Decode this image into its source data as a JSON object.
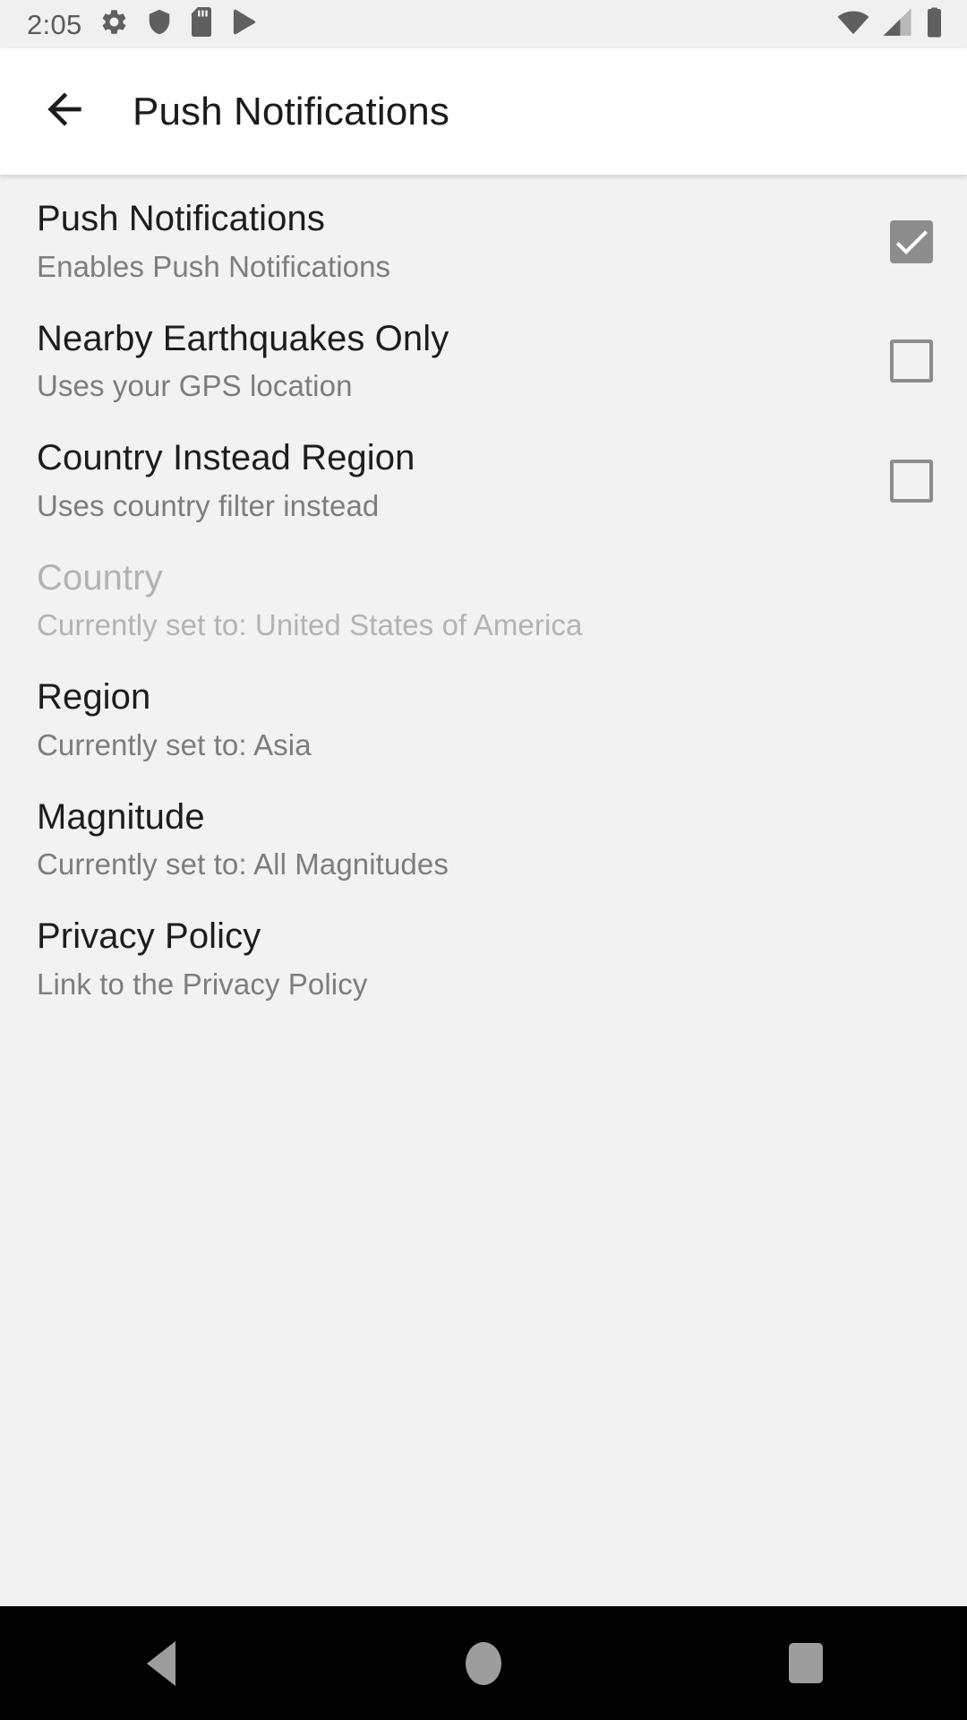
{
  "status_bar": {
    "time": "2:05",
    "left_icons": [
      "gear-icon",
      "shield-icon",
      "sd-card-icon",
      "play-store-icon"
    ],
    "right_icons": [
      "wifi-icon",
      "cellular-signal-icon",
      "battery-icon"
    ],
    "icon_color": "#5f5f5f",
    "background": "#f0f0f0"
  },
  "app_bar": {
    "back_icon": "arrow-left-icon",
    "title": "Push Notifications",
    "background": "#ffffff",
    "title_color": "#1b1b1b"
  },
  "content": {
    "background": "#f2f2f2",
    "preferences": [
      {
        "key": "push-notifications",
        "title": "Push Notifications",
        "summary": "Enables Push Notifications",
        "widget": "checkbox",
        "checked": true,
        "enabled": true
      },
      {
        "key": "nearby-earthquakes-only",
        "title": "Nearby Earthquakes Only",
        "summary": "Uses your GPS location",
        "widget": "checkbox",
        "checked": false,
        "enabled": true
      },
      {
        "key": "country-instead-region",
        "title": "Country Instead Region",
        "summary": "Uses country filter instead",
        "widget": "checkbox",
        "checked": false,
        "enabled": true
      },
      {
        "key": "country",
        "title": "Country",
        "summary": "Currently set to: United States of America",
        "widget": "none",
        "checked": null,
        "enabled": false
      },
      {
        "key": "region",
        "title": "Region",
        "summary": "Currently set to: Asia",
        "widget": "none",
        "checked": null,
        "enabled": true
      },
      {
        "key": "magnitude",
        "title": "Magnitude",
        "summary": "Currently set to: All Magnitudes",
        "widget": "none",
        "checked": null,
        "enabled": true
      },
      {
        "key": "privacy-policy",
        "title": "Privacy Policy",
        "summary": "Link to the Privacy Policy",
        "widget": "none",
        "checked": null,
        "enabled": true
      }
    ],
    "checkbox_color": "#8d8d8d",
    "title_color": "#1d1d1d",
    "summary_color": "#7d7d7d",
    "disabled_color": "#b3b3b3"
  },
  "nav_bar": {
    "background": "#000000",
    "icon_color": "#9d9d9d",
    "buttons": [
      {
        "key": "back",
        "icon": "triangle-back-icon"
      },
      {
        "key": "home",
        "icon": "circle-home-icon"
      },
      {
        "key": "recents",
        "icon": "square-recents-icon"
      }
    ]
  }
}
